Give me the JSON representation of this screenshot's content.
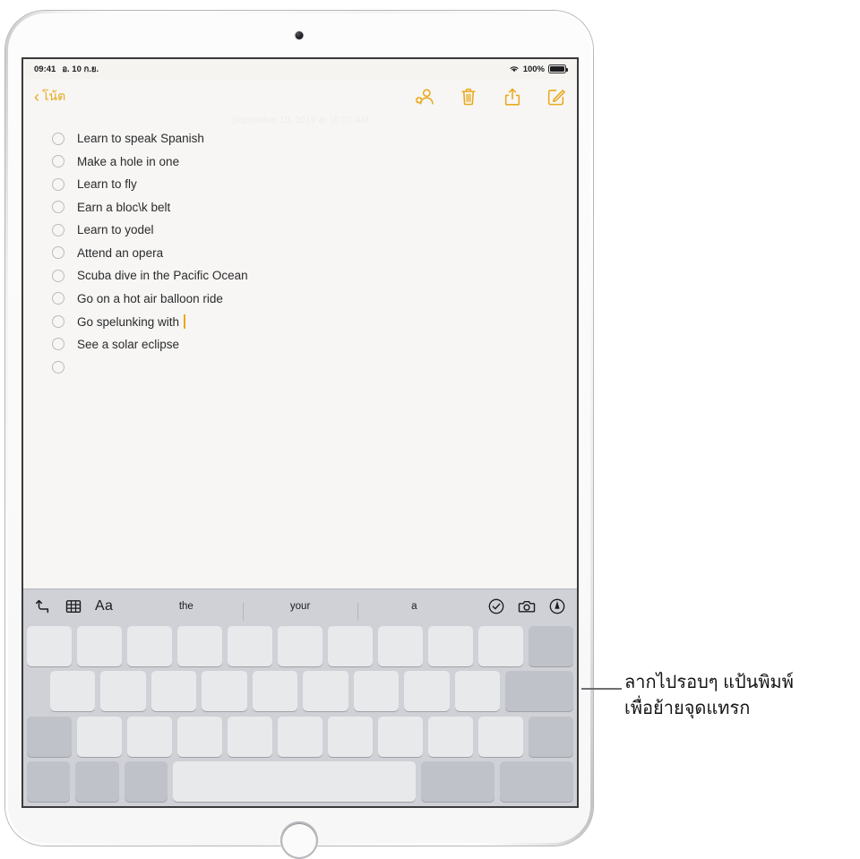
{
  "device": {
    "name": "ipad",
    "front_camera_icon": "camera-dot-icon",
    "home_button_icon": "home-button-icon"
  },
  "status_bar": {
    "time": "09:41",
    "date": "อ. 10 ก.ย.",
    "wifi_icon": "wifi-icon",
    "battery_percent": "100%",
    "battery_icon": "battery-full-icon"
  },
  "nav_bar": {
    "back_chevron_icon": "chevron-left-icon",
    "back_label": "โน้ต",
    "accent_color": "#e8a91d",
    "actions": [
      {
        "name": "add-person-button",
        "icon": "person-add-icon"
      },
      {
        "name": "delete-button",
        "icon": "trash-icon"
      },
      {
        "name": "share-button",
        "icon": "share-icon"
      },
      {
        "name": "compose-button",
        "icon": "compose-icon"
      }
    ]
  },
  "note": {
    "date_header": "September 10, 2019 at 10:07 AM",
    "checklist": [
      {
        "text": "Learn to speak Spanish",
        "checked": false
      },
      {
        "text": "Make a hole in one",
        "checked": false
      },
      {
        "text": "Learn to fly",
        "checked": false
      },
      {
        "text": "Earn a bloc\\k belt",
        "checked": false
      },
      {
        "text": "Learn to yodel",
        "checked": false
      },
      {
        "text": "Attend an opera",
        "checked": false
      },
      {
        "text": "Scuba dive in the Pacific Ocean",
        "checked": false
      },
      {
        "text": "Go on a hot air balloon ride",
        "checked": false
      },
      {
        "text": "Go spelunking with",
        "checked": false,
        "cursor": true
      },
      {
        "text": "See a solar eclipse",
        "checked": false
      },
      {
        "text": "",
        "checked": false
      }
    ]
  },
  "keyboard": {
    "toolbar": {
      "undo_icon": "undo-arrow-icon",
      "table_icon": "table-icon",
      "format_label": "Aa",
      "predictions": [
        "the",
        "your",
        "a"
      ],
      "checklist_icon": "checkmark-circle-icon",
      "camera_icon": "camera-icon",
      "markup_icon": "markup-pen-icon"
    }
  },
  "callout": {
    "line1": "ลากไปรอบๆ แป้นพิมพ์",
    "line2": "เพื่อย้ายจุดแทรก"
  }
}
